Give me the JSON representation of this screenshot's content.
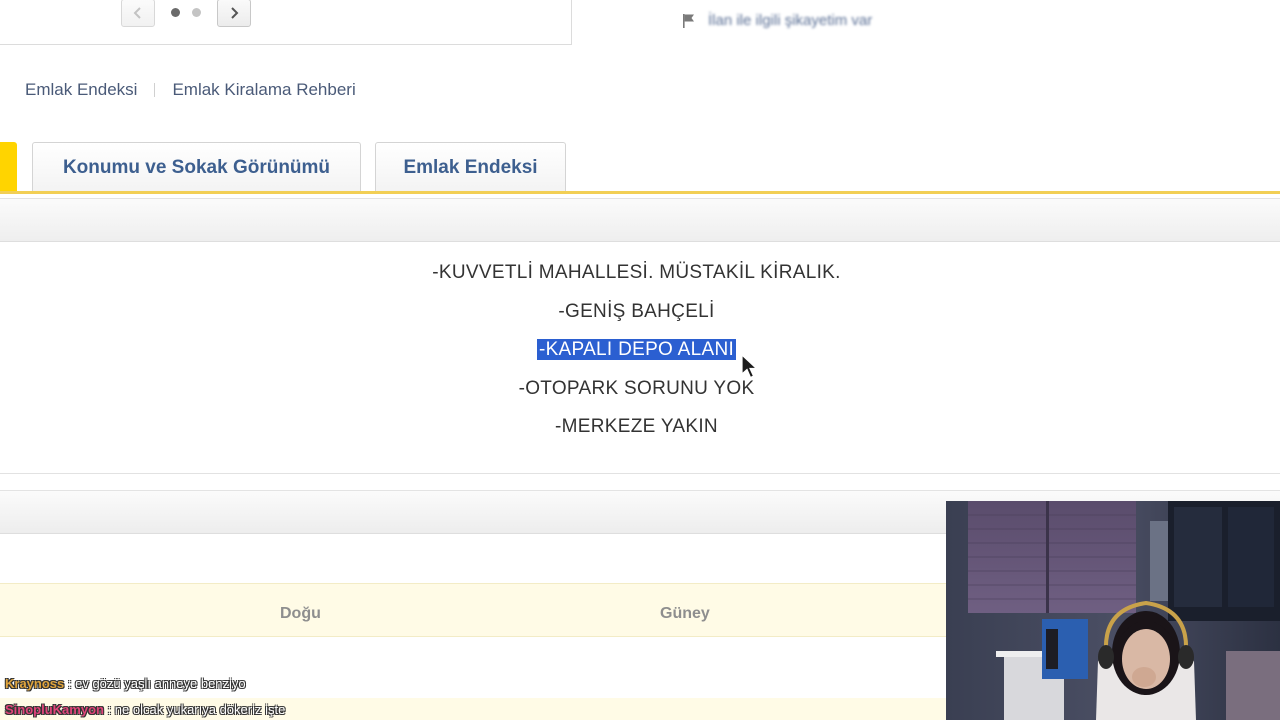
{
  "gallery": {
    "prev_label": "Previous",
    "next_label": "Next"
  },
  "complaint": {
    "text": "İlan ile ilgili şikayetim var"
  },
  "links": [
    {
      "label": "Emlak Endeksi"
    },
    {
      "label": "Emlak Kiralama Rehberi"
    }
  ],
  "tabs": [
    {
      "label": "Konumu ve Sokak Görünümü"
    },
    {
      "label": "Emlak Endeksi"
    }
  ],
  "description": {
    "lines": [
      "-KUVVETLİ MAHALLESİ. MÜSTAKİL KİRALIK.",
      "-GENİŞ BAHÇELİ",
      "-KAPALI DEPO ALANI",
      "-OTOPARK SORUNU YOK",
      "-MERKEZE YAKIN"
    ],
    "selected_line_index": 2
  },
  "directions": {
    "east": "Doğu",
    "south": "Güney"
  },
  "chat": [
    {
      "user": "Kraynoss",
      "message": ": ev gözü yaşlı anneye benziyo",
      "color": "#e0a43c"
    },
    {
      "user": "SinopluKamyon",
      "message": ": ne olcak yukarıya dökeriz işte",
      "color": "#e0457a"
    }
  ],
  "colors": {
    "tab_accent": "#ffd400",
    "tab_text": "#3d5f8f",
    "selection": "#2b5fd1"
  }
}
